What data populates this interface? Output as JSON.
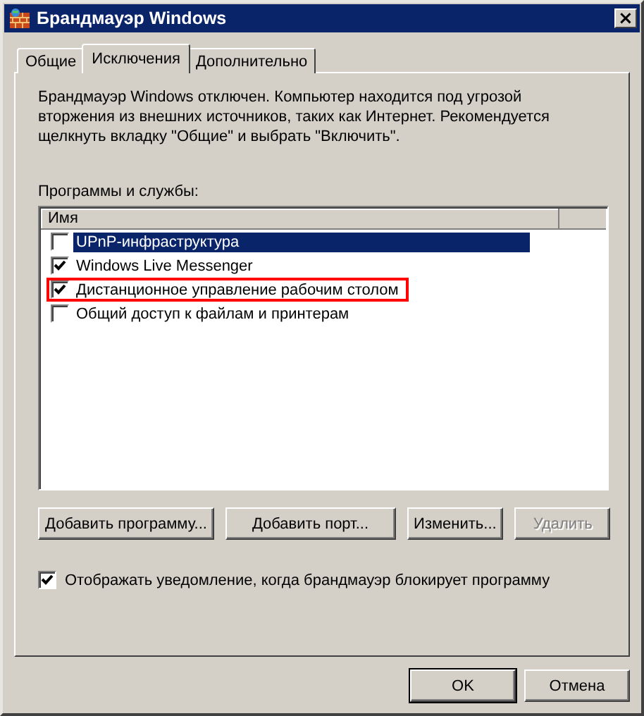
{
  "window": {
    "title": "Брандмауэр Windows",
    "close": "×"
  },
  "tabs": [
    {
      "label": "Общие",
      "selected": false
    },
    {
      "label": "Исключения",
      "selected": true
    },
    {
      "label": "Дополнительно",
      "selected": false
    }
  ],
  "message": "Брандмауэр Windows отключен. Компьютер находится под угрозой вторжения из внешних источников, таких как Интернет. Рекомендуется щелкнуть вкладку \"Общие\" и выбрать \"Включить\".",
  "programs": {
    "label": "Программы и службы:",
    "column": "Имя",
    "items": [
      {
        "name": "UPnP-инфраструктура",
        "checked": false,
        "selected": true,
        "highlighted": false
      },
      {
        "name": "Windows Live Messenger",
        "checked": true,
        "selected": false,
        "highlighted": false
      },
      {
        "name": "Дистанционное управление рабочим столом",
        "checked": true,
        "selected": false,
        "highlighted": true
      },
      {
        "name": "Общий доступ к файлам и принтерам",
        "checked": false,
        "selected": false,
        "highlighted": false
      }
    ]
  },
  "actions": [
    {
      "label": "Добавить программу...",
      "disabled": false
    },
    {
      "label": "Добавить порт...",
      "disabled": false
    },
    {
      "label": "Изменить...",
      "disabled": false
    },
    {
      "label": "Удалить",
      "disabled": true
    }
  ],
  "notify": {
    "label": "Отображать уведомление, когда брандмауэр блокирует программу",
    "checked": true
  },
  "buttons": [
    {
      "label": "OK",
      "default": true
    },
    {
      "label": "Отмена",
      "default": false
    }
  ]
}
